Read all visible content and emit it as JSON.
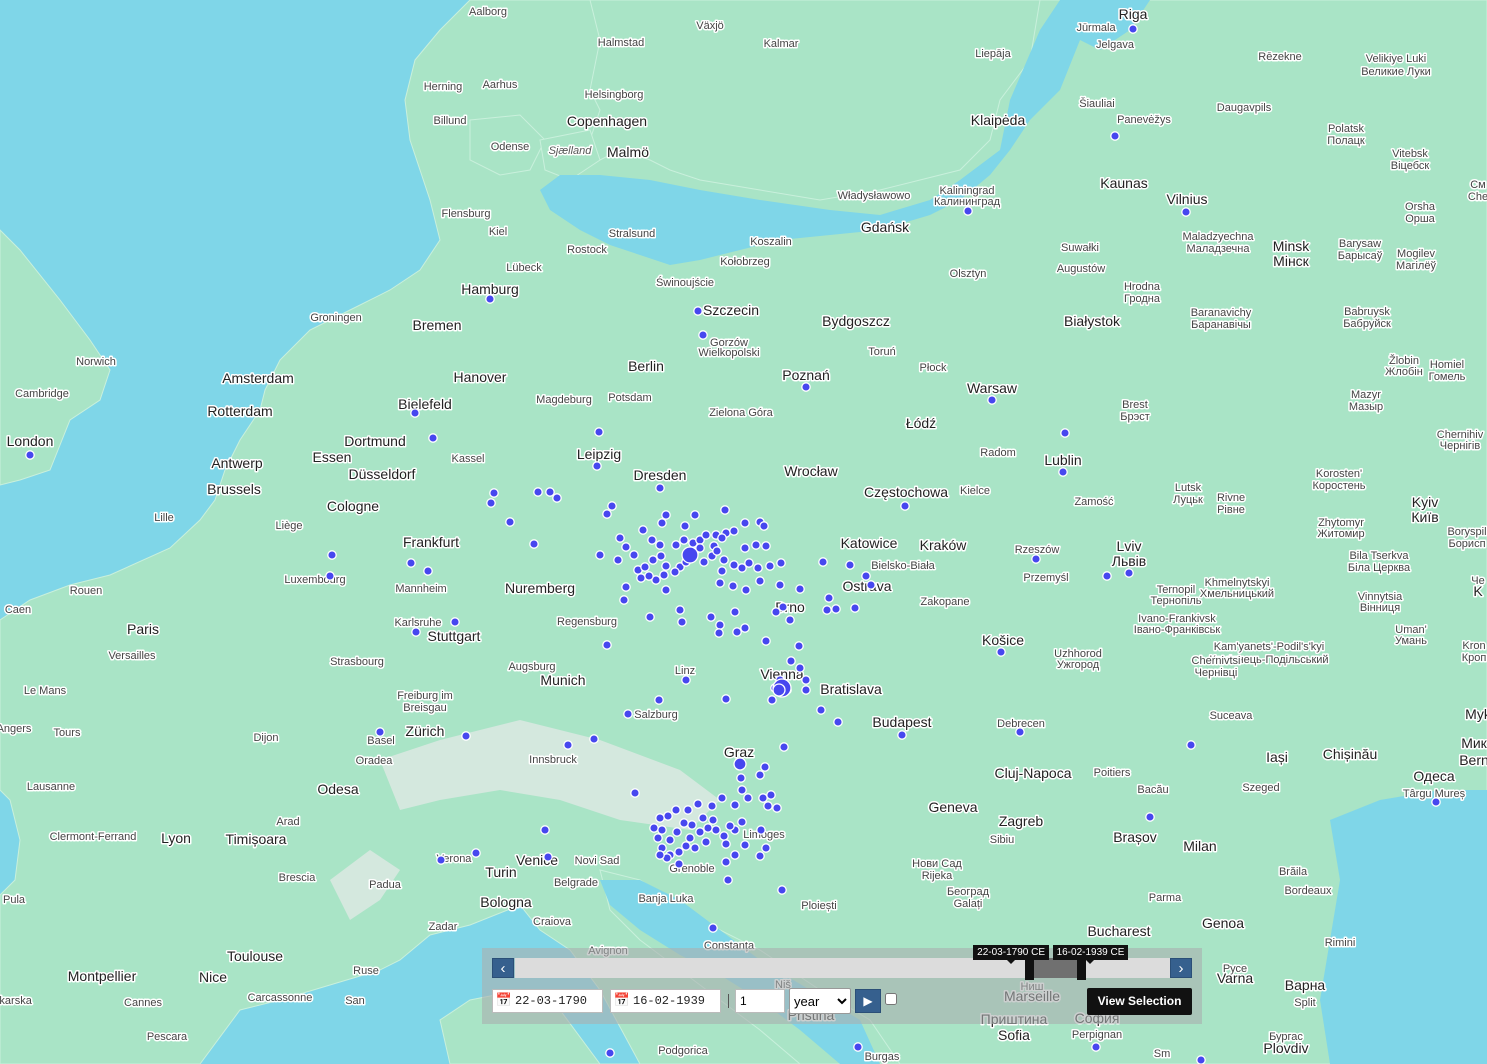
{
  "map": {
    "water_color": "#7fd6e8",
    "land_color": "#a9e4c6",
    "marker_color": "#4747ef",
    "labels": [
      {
        "text": "Aalborg",
        "size": "s"
      },
      {
        "text": "Växjö",
        "size": "s"
      },
      {
        "text": "Kalmar",
        "size": "s"
      },
      {
        "text": "Halmstad",
        "size": "s"
      },
      {
        "text": "Riga",
        "size": "l"
      },
      {
        "text": "Jūrmala",
        "size": "s"
      },
      {
        "text": "Jelgava",
        "size": "s"
      },
      {
        "text": "Rēzekne",
        "size": "s"
      },
      {
        "text": "Liepāja",
        "size": "s"
      },
      {
        "text": "Velikiye Luki",
        "size": "s"
      },
      {
        "text": "Великие Луки",
        "size": "s"
      },
      {
        "text": "Herning",
        "size": "s"
      },
      {
        "text": "Aarhus",
        "size": "s"
      },
      {
        "text": "Helsingborg",
        "size": "s"
      },
      {
        "text": "Billund",
        "size": "s"
      },
      {
        "text": "Copenhagen",
        "size": "l"
      },
      {
        "text": "Malmö",
        "size": "l"
      },
      {
        "text": "Sjælland",
        "size": "i"
      },
      {
        "text": "Odense",
        "size": "s"
      },
      {
        "text": "Šiauliai",
        "size": "s"
      },
      {
        "text": "Panevėžys",
        "size": "s"
      },
      {
        "text": "Daugavpils",
        "size": "s"
      },
      {
        "text": "Klaipėda",
        "size": "l"
      },
      {
        "text": "Polatsk",
        "size": "s"
      },
      {
        "text": "Полацк",
        "size": "s"
      },
      {
        "text": "Vitebsk",
        "size": "s"
      },
      {
        "text": "Віцебск",
        "size": "s"
      },
      {
        "text": "Kaunas",
        "size": "l"
      },
      {
        "text": "Vilnius",
        "size": "l"
      },
      {
        "text": "Władysławowo",
        "size": "s"
      },
      {
        "text": "Kaliningrad",
        "size": "s"
      },
      {
        "text": "Калининград",
        "size": "s"
      },
      {
        "text": "Flensburg",
        "size": "s"
      },
      {
        "text": "Stralsund",
        "size": "s"
      },
      {
        "text": "Kiel",
        "size": "s"
      },
      {
        "text": "Rostock",
        "size": "s"
      },
      {
        "text": "Koszalin",
        "size": "s"
      },
      {
        "text": "Gdańsk",
        "size": "l"
      },
      {
        "text": "Orsha",
        "size": "s"
      },
      {
        "text": "Орша",
        "size": "s"
      },
      {
        "text": "Suwałki",
        "size": "s"
      },
      {
        "text": "Maladzyechna",
        "size": "s"
      },
      {
        "text": "Маладзечна",
        "size": "s"
      },
      {
        "text": "Minsk",
        "size": "l"
      },
      {
        "text": "Мінск",
        "size": "l"
      },
      {
        "text": "Barysaw",
        "size": "s"
      },
      {
        "text": "Барысаў",
        "size": "s"
      },
      {
        "text": "Mogilev",
        "size": "s"
      },
      {
        "text": "Магілёў",
        "size": "s"
      },
      {
        "text": "Lübeck",
        "size": "s"
      },
      {
        "text": "Kołobrzeg",
        "size": "s"
      },
      {
        "text": "Świnoujście",
        "size": "s"
      },
      {
        "text": "Olsztyn",
        "size": "s"
      },
      {
        "text": "Augustów",
        "size": "s"
      },
      {
        "text": "Hrodna",
        "size": "s"
      },
      {
        "text": "Гродна",
        "size": "s"
      },
      {
        "text": "Hamburg",
        "size": "l"
      },
      {
        "text": "Szczecin",
        "size": "l"
      },
      {
        "text": "Groningen",
        "size": "s"
      },
      {
        "text": "Bremen",
        "size": "l"
      },
      {
        "text": "Bydgoszcz",
        "size": "l"
      },
      {
        "text": "Białystok",
        "size": "l"
      },
      {
        "text": "Baranavichy",
        "size": "s"
      },
      {
        "text": "Баранавічы",
        "size": "s"
      },
      {
        "text": "Babruysk",
        "size": "s"
      },
      {
        "text": "Бабруйск",
        "size": "s"
      },
      {
        "text": "Gorzów",
        "size": "s"
      },
      {
        "text": "Wielkopolski",
        "size": "s"
      },
      {
        "text": "Toruń",
        "size": "s"
      },
      {
        "text": "Norwich",
        "size": "s"
      },
      {
        "text": "Amsterdam",
        "size": "l"
      },
      {
        "text": "Hanover",
        "size": "l"
      },
      {
        "text": "Berlin",
        "size": "l"
      },
      {
        "text": "Poznań",
        "size": "l"
      },
      {
        "text": "Płock",
        "size": "s"
      },
      {
        "text": "Žlobin",
        "size": "s"
      },
      {
        "text": "Жлобін",
        "size": "s"
      },
      {
        "text": "Homiel",
        "size": "s"
      },
      {
        "text": "Гомель",
        "size": "s"
      },
      {
        "text": "Cambridge",
        "size": "s"
      },
      {
        "text": "Rotterdam",
        "size": "l"
      },
      {
        "text": "Bielefeld",
        "size": "l"
      },
      {
        "text": "Magdeburg",
        "size": "s"
      },
      {
        "text": "Potsdam",
        "size": "s"
      },
      {
        "text": "Warsaw",
        "size": "l"
      },
      {
        "text": "Mazyr",
        "size": "s"
      },
      {
        "text": "Мазыр",
        "size": "s"
      },
      {
        "text": "Brest",
        "size": "s"
      },
      {
        "text": "Брэст",
        "size": "s"
      },
      {
        "text": "Zielona Góra",
        "size": "s"
      },
      {
        "text": "Łódź",
        "size": "l"
      },
      {
        "text": "London",
        "size": "l"
      },
      {
        "text": "Dortmund",
        "size": "l"
      },
      {
        "text": "Chernihiv",
        "size": "s"
      },
      {
        "text": "Чернігів",
        "size": "s"
      },
      {
        "text": "Essen",
        "size": "l"
      },
      {
        "text": "Kassel",
        "size": "s"
      },
      {
        "text": "Leipzig",
        "size": "l"
      },
      {
        "text": "Radom",
        "size": "s"
      },
      {
        "text": "Lublin",
        "size": "l"
      },
      {
        "text": "Antwerp",
        "size": "l"
      },
      {
        "text": "Düsseldorf",
        "size": "l"
      },
      {
        "text": "Dresden",
        "size": "l"
      },
      {
        "text": "Wrocław",
        "size": "l"
      },
      {
        "text": "Korosten'",
        "size": "s"
      },
      {
        "text": "Коростень",
        "size": "s"
      },
      {
        "text": "Brussels",
        "size": "l"
      },
      {
        "text": "Lutsk",
        "size": "s"
      },
      {
        "text": "Луцьк",
        "size": "s"
      },
      {
        "text": "Częstochowa",
        "size": "l"
      },
      {
        "text": "Kielce",
        "size": "s"
      },
      {
        "text": "Zamość",
        "size": "s"
      },
      {
        "text": "Rivne",
        "size": "s"
      },
      {
        "text": "Рівне",
        "size": "s"
      },
      {
        "text": "Kyiv",
        "size": "l"
      },
      {
        "text": "Київ",
        "size": "l"
      },
      {
        "text": "Cologne",
        "size": "l"
      },
      {
        "text": "Lille",
        "size": "s"
      },
      {
        "text": "Liège",
        "size": "s"
      },
      {
        "text": "Zhytomyr",
        "size": "s"
      },
      {
        "text": "Житомир",
        "size": "s"
      },
      {
        "text": "Boryspil",
        "size": "s"
      },
      {
        "text": "Борисп",
        "size": "s"
      },
      {
        "text": "Frankfurt",
        "size": "l"
      },
      {
        "text": "Katowice",
        "size": "l"
      },
      {
        "text": "Kraków",
        "size": "l"
      },
      {
        "text": "Rzeszów",
        "size": "s"
      },
      {
        "text": "Lviv",
        "size": "l"
      },
      {
        "text": "Львів",
        "size": "l"
      },
      {
        "text": "Bila Tserkva",
        "size": "s"
      },
      {
        "text": "Біла Церква",
        "size": "s"
      },
      {
        "text": "Luxembourg",
        "size": "s"
      },
      {
        "text": "Bielsko-Biała",
        "size": "s"
      },
      {
        "text": "Przemyśl",
        "size": "s"
      },
      {
        "text": "Mannheim",
        "size": "s"
      },
      {
        "text": "Nuremberg",
        "size": "l"
      },
      {
        "text": "Ostrava",
        "size": "l"
      },
      {
        "text": "Khmelnytskyi",
        "size": "s"
      },
      {
        "text": "Хмельницький",
        "size": "s"
      },
      {
        "text": "Ternopil",
        "size": "s"
      },
      {
        "text": "Тернопіль",
        "size": "s"
      },
      {
        "text": "Rouen",
        "size": "s"
      },
      {
        "text": "Vinnytsia",
        "size": "s"
      },
      {
        "text": "Вінниця",
        "size": "s"
      },
      {
        "text": "Caen",
        "size": "s"
      },
      {
        "text": "Brno",
        "size": "l"
      },
      {
        "text": "Zakopane",
        "size": "s"
      },
      {
        "text": "Ivano-Frankivsk",
        "size": "s"
      },
      {
        "text": "Івано-Франківськ",
        "size": "s"
      },
      {
        "text": "Karlsruhe",
        "size": "s"
      },
      {
        "text": "Regensburg",
        "size": "s"
      },
      {
        "text": "Stuttgart",
        "size": "l"
      },
      {
        "text": "Paris",
        "size": "l"
      },
      {
        "text": "Košice",
        "size": "l"
      },
      {
        "text": "Uman'",
        "size": "s"
      },
      {
        "text": "Умань",
        "size": "s"
      },
      {
        "text": "Versailles",
        "size": "s"
      },
      {
        "text": "Kam'yanets'-Podil's'kyi",
        "size": "s"
      },
      {
        "text": "Кам'янець-Подільський",
        "size": "s"
      },
      {
        "text": "Uzhhorod",
        "size": "s"
      },
      {
        "text": "Ужгород",
        "size": "s"
      },
      {
        "text": "Kron",
        "size": "s"
      },
      {
        "text": "Кроп",
        "size": "s"
      },
      {
        "text": "Strasbourg",
        "size": "s"
      },
      {
        "text": "Augsburg",
        "size": "s"
      },
      {
        "text": "Linz",
        "size": "s"
      },
      {
        "text": "Vienna",
        "size": "l"
      },
      {
        "text": "Chernivtsi",
        "size": "s"
      },
      {
        "text": "Чернівці",
        "size": "s"
      },
      {
        "text": "Munich",
        "size": "l"
      },
      {
        "text": "Bratislava",
        "size": "l"
      },
      {
        "text": "Le Mans",
        "size": "s"
      },
      {
        "text": "Freiburg im",
        "size": "s"
      },
      {
        "text": "Breisgau",
        "size": "s"
      },
      {
        "text": "Salzburg",
        "size": "s"
      },
      {
        "text": "Budapest",
        "size": "l"
      },
      {
        "text": "Debrecen",
        "size": "s"
      },
      {
        "text": "Suceava",
        "size": "s"
      },
      {
        "text": "Angers",
        "size": "s"
      },
      {
        "text": "Tours",
        "size": "s"
      },
      {
        "text": "Dijon",
        "size": "s"
      },
      {
        "text": "Basel",
        "size": "s"
      },
      {
        "text": "Zürich",
        "size": "l"
      },
      {
        "text": "Innsbruck",
        "size": "s"
      },
      {
        "text": "Graz",
        "size": "l"
      },
      {
        "text": "Iași",
        "size": "l"
      },
      {
        "text": "Chișinău",
        "size": "l"
      },
      {
        "text": "Myk",
        "size": "l"
      },
      {
        "text": "Мик",
        "size": "l"
      },
      {
        "text": "Bern",
        "size": "l"
      },
      {
        "text": "Oradea",
        "size": "s"
      },
      {
        "text": "Cluj-Napoca",
        "size": "l"
      },
      {
        "text": "Poitiers",
        "size": "s"
      },
      {
        "text": "Lausanne",
        "size": "s"
      },
      {
        "text": "Odesa",
        "size": "l"
      },
      {
        "text": "Одеса",
        "size": "l"
      },
      {
        "text": "Târgu Mureș",
        "size": "s"
      },
      {
        "text": "Bacău",
        "size": "s"
      },
      {
        "text": "Szeged",
        "size": "s"
      },
      {
        "text": "Geneva",
        "size": "l"
      },
      {
        "text": "Arad",
        "size": "s"
      },
      {
        "text": "Zagreb",
        "size": "l"
      },
      {
        "text": "Limoges",
        "size": "s"
      },
      {
        "text": "Clermont-Ferrand",
        "size": "s"
      },
      {
        "text": "Lyon",
        "size": "l"
      },
      {
        "text": "Timișoara",
        "size": "l"
      },
      {
        "text": "Sibiu",
        "size": "s"
      },
      {
        "text": "Brașov",
        "size": "l"
      },
      {
        "text": "Milan",
        "size": "l"
      },
      {
        "text": "Verona",
        "size": "s"
      },
      {
        "text": "Venice",
        "size": "l"
      },
      {
        "text": "Novi Sad",
        "size": "s"
      },
      {
        "text": "Нови Сад",
        "size": "s"
      },
      {
        "text": "Rijeka",
        "size": "s"
      },
      {
        "text": "Grenoble",
        "size": "s"
      },
      {
        "text": "Brescia",
        "size": "s"
      },
      {
        "text": "Turin",
        "size": "l"
      },
      {
        "text": "Padua",
        "size": "s"
      },
      {
        "text": "Belgrade",
        "size": "s"
      },
      {
        "text": "Београд",
        "size": "s"
      },
      {
        "text": "Galați",
        "size": "s"
      },
      {
        "text": "Brăila",
        "size": "s"
      },
      {
        "text": "Bordeaux",
        "size": "s"
      },
      {
        "text": "Pula",
        "size": "s"
      },
      {
        "text": "Banja Luka",
        "size": "s"
      },
      {
        "text": "Ploiești",
        "size": "s"
      },
      {
        "text": "Parma",
        "size": "s"
      },
      {
        "text": "Bologna",
        "size": "l"
      },
      {
        "text": "Craiova",
        "size": "s"
      },
      {
        "text": "Bucharest",
        "size": "l"
      },
      {
        "text": "Genoa",
        "size": "l"
      },
      {
        "text": "Zadar",
        "size": "s"
      },
      {
        "text": "Constanța",
        "size": "s"
      },
      {
        "text": "Rimini",
        "size": "s"
      },
      {
        "text": "Avignon",
        "size": "s"
      },
      {
        "text": "Toulouse",
        "size": "l"
      },
      {
        "text": "Montpellier",
        "size": "l"
      },
      {
        "text": "Nice",
        "size": "l"
      },
      {
        "text": "Ruse",
        "size": "s"
      },
      {
        "text": "Русе",
        "size": "s"
      },
      {
        "text": "Varna",
        "size": "l"
      },
      {
        "text": "Варна",
        "size": "l"
      },
      {
        "text": "Split",
        "size": "s"
      },
      {
        "text": "Niš",
        "size": "s"
      },
      {
        "text": "Ниш",
        "size": "s"
      },
      {
        "text": "Marseille",
        "size": "l"
      },
      {
        "text": "Carcassonne",
        "size": "s"
      },
      {
        "text": "Cannes",
        "size": "s"
      },
      {
        "text": "San",
        "size": "s"
      },
      {
        "text": "Makarska",
        "size": "s"
      },
      {
        "text": "Pristina",
        "size": "l"
      },
      {
        "text": "Приштина",
        "size": "l"
      },
      {
        "text": "Sofia",
        "size": "l"
      },
      {
        "text": "София",
        "size": "l"
      },
      {
        "text": "Perpignan",
        "size": "s"
      },
      {
        "text": "Pescara",
        "size": "s"
      },
      {
        "text": "Podgorica",
        "size": "s"
      },
      {
        "text": "Burgas",
        "size": "s"
      },
      {
        "text": "Бургас",
        "size": "s"
      },
      {
        "text": "Plovdiv",
        "size": "l"
      },
      {
        "text": "Sm",
        "size": "s"
      },
      {
        "text": "См",
        "size": "s"
      },
      {
        "text": "Che",
        "size": "s"
      },
      {
        "text": "Че",
        "size": "s"
      },
      {
        "text": "K",
        "size": "l"
      }
    ]
  },
  "timeline": {
    "prev_icon": "chevron-left-icon",
    "next_icon": "chevron-right-icon",
    "start_label": "22-03-1790 CE",
    "end_label": "16-02-1939 CE",
    "range_start_fraction": 0.785,
    "range_end_fraction": 0.865,
    "start_date": "22-03-1790",
    "end_date": "16-02-1939",
    "calendar_icon": "calendar-icon",
    "step_value": "1",
    "step_unit": "year",
    "unit_options": [
      "year"
    ],
    "play_icon": "play-icon",
    "view_selection_label": "View Selection"
  }
}
